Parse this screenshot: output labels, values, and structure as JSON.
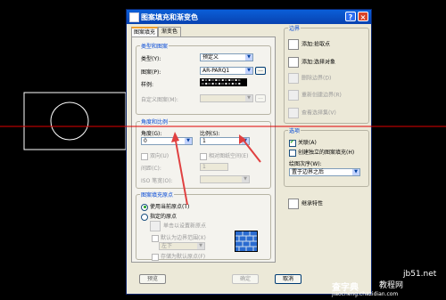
{
  "dialog": {
    "title": "图案填充和渐变色",
    "help_button": "?",
    "close_button": "×"
  },
  "tabs": [
    {
      "label": "图案填充"
    },
    {
      "label": "渐变色"
    }
  ],
  "type_pattern": {
    "group_label": "类型和图案",
    "type_label": "类型(Y):",
    "type_value": "预定义",
    "pattern_label": "图案(P):",
    "pattern_value": "AR-PARQ1",
    "browse_button": "...",
    "sample_label": "样例:",
    "custom_label": "自定义图案(M):",
    "custom_button": "..."
  },
  "angle_scale": {
    "group_label": "角度和比例",
    "angle_label": "角度(G):",
    "angle_value": "0",
    "scale_label": "比例(S):",
    "scale_value": "1",
    "double_label": "双向(U)",
    "relative_label": "相对图纸空间(E)",
    "spacing_label": "间距(C):",
    "spacing_value": "1",
    "iso_label": "ISO 笔宽(O):"
  },
  "origin": {
    "group_label": "图案填充原点",
    "use_current": "使用当前原点(T)",
    "specified": "指定的原点",
    "click_set": "单击以设置新原点",
    "default_extent": "默认为边界范围(X)",
    "extent_value": "左下",
    "store_default": "存储为默认原点(F)"
  },
  "boundaries": {
    "group_label": "边界",
    "add_pick": "添加:拾取点",
    "add_select": "添加:选择对象",
    "remove": "删除边界(D)",
    "recreate": "重新创建边界(R)",
    "view": "查看选择集(V)"
  },
  "options": {
    "group_label": "选项",
    "associative": "关联(A)",
    "associative_checked": true,
    "separate": "创建独立的图案填充(H)",
    "draw_order_label": "绘图次序(W):",
    "draw_order_value": "置于边界之后"
  },
  "inherit_button": "继承特性",
  "footer": {
    "preview": "预览",
    "ok": "确定",
    "cancel": "取消"
  },
  "watermark": {
    "site": "jb51.net",
    "line1": "查字典",
    "line2": "教程网",
    "line3": "jiaocheng.chazidian.com"
  },
  "colors": {
    "crosshair": "#e00000",
    "titlebar": "#0a5fd8",
    "arrow": "#e04040"
  }
}
